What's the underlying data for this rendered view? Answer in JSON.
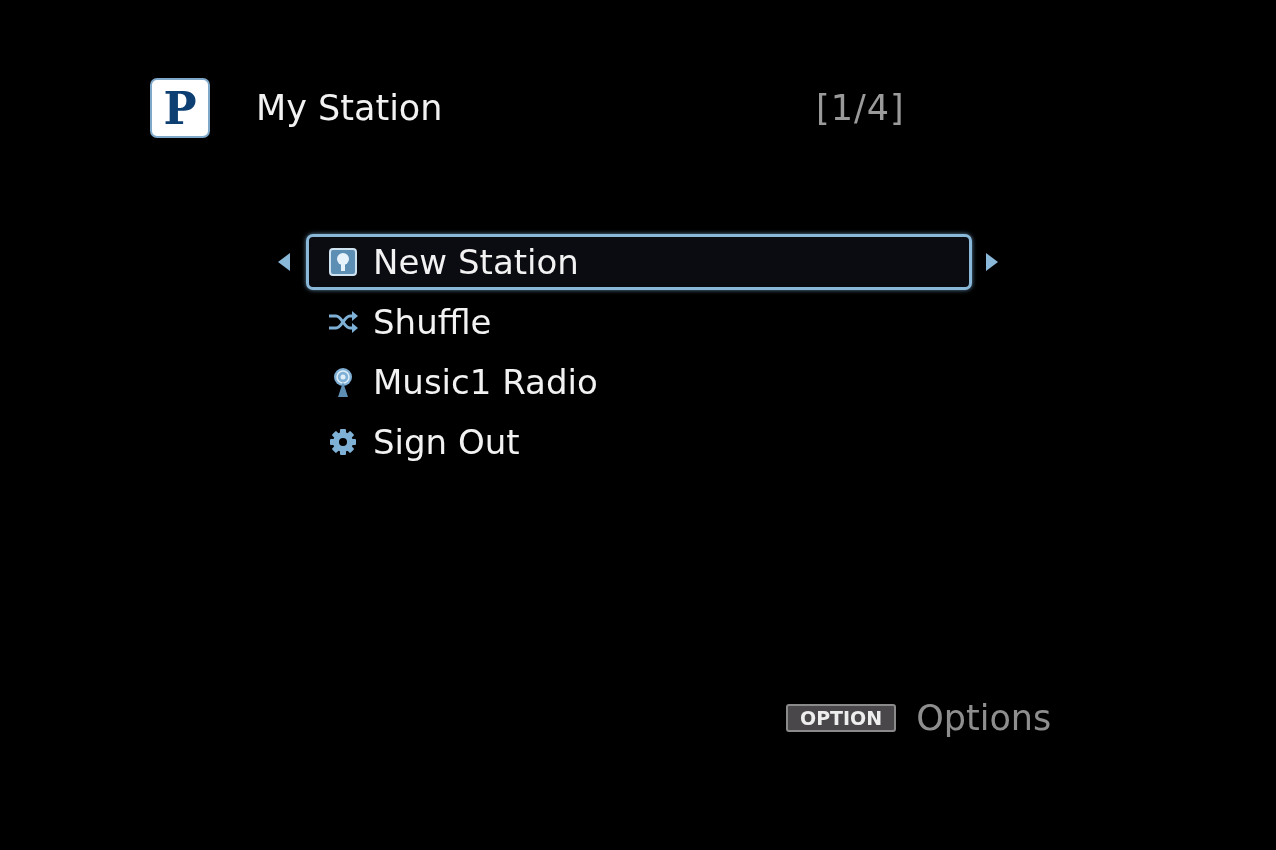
{
  "header": {
    "logo": "P",
    "title": "My Station",
    "page": "[1/4]"
  },
  "menu": [
    {
      "kind": "station",
      "label": "New Station",
      "selected": true
    },
    {
      "kind": "shuffle",
      "label": "Shuffle",
      "selected": false
    },
    {
      "kind": "radio",
      "label": "Music1 Radio",
      "selected": false
    },
    {
      "kind": "settings",
      "label": "Sign Out",
      "selected": false
    }
  ],
  "footer": {
    "key": "OPTION",
    "label": "Options"
  }
}
